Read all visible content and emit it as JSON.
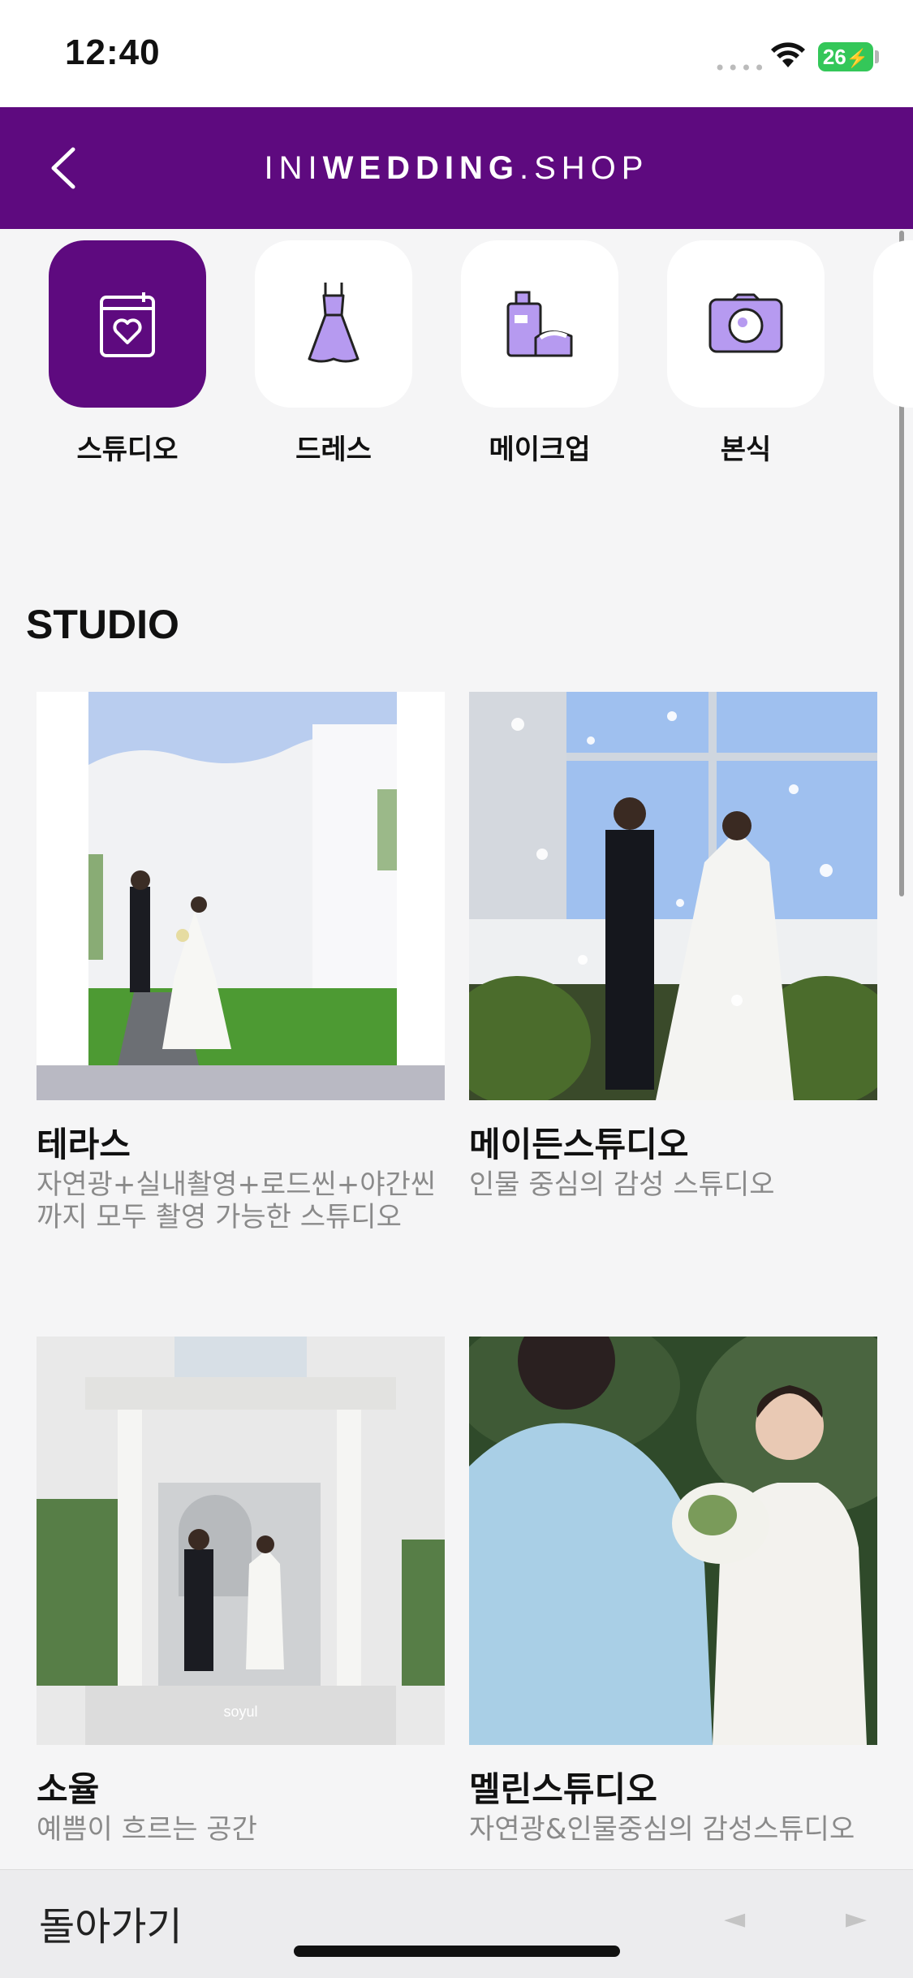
{
  "status": {
    "time": "12:40",
    "battery": "26"
  },
  "header": {
    "brand_part1": "INI",
    "brand_part2": "WEDDING",
    "brand_part3": ".SHOP"
  },
  "categories": [
    {
      "label": "스튜디오",
      "icon": "calendar-heart-icon",
      "active": true
    },
    {
      "label": "드레스",
      "icon": "dress-icon",
      "active": false
    },
    {
      "label": "메이크업",
      "icon": "makeup-icon",
      "active": false
    },
    {
      "label": "본식",
      "icon": "camera-icon",
      "active": false
    }
  ],
  "section": {
    "title": "STUDIO"
  },
  "studios": [
    {
      "name": "테라스",
      "description": "자연광+실내촬영+로드씬+야간씬까지 모두 촬영 가능한 스튜디오"
    },
    {
      "name": "메이든스튜디오",
      "description": "인물 중심의 감성 스튜디오"
    },
    {
      "name": "소율",
      "description": "예쁨이 흐르는 공간",
      "watermark": "soyul"
    },
    {
      "name": "멜린스튜디오",
      "description": "자연광&인물중심의 감성스튜디오"
    }
  ],
  "bottom_bar": {
    "back_label": "돌아가기",
    "prev": "◄",
    "next": "►"
  },
  "colors": {
    "accent": "#5e0a7f",
    "icon_fill": "#b69af0"
  }
}
